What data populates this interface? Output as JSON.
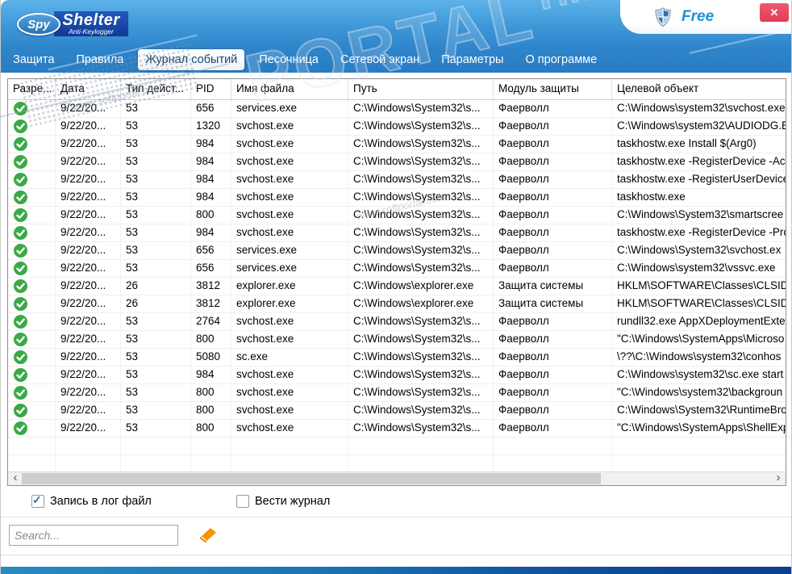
{
  "app": {
    "logo": {
      "spy": "Spy",
      "name": "Shelter",
      "subtitle": "Anti-Keylogger"
    },
    "license_badge": "Free",
    "close_glyph": "✕"
  },
  "tabs": [
    {
      "id": "protection",
      "label": "Защита",
      "active": false
    },
    {
      "id": "rules",
      "label": "Правила",
      "active": false
    },
    {
      "id": "event-log",
      "label": "Журнал событий",
      "active": true
    },
    {
      "id": "sandbox",
      "label": "Песочница",
      "active": false
    },
    {
      "id": "firewall",
      "label": "Сетевой экран",
      "active": false
    },
    {
      "id": "settings",
      "label": "Параметры",
      "active": false
    },
    {
      "id": "about",
      "label": "О программе",
      "active": false
    }
  ],
  "log_table": {
    "columns": [
      {
        "id": "allowed",
        "label": "Разре..."
      },
      {
        "id": "date",
        "label": "Дата"
      },
      {
        "id": "action-type",
        "label": "Тип дейст..."
      },
      {
        "id": "pid",
        "label": "PID"
      },
      {
        "id": "file-name",
        "label": "Имя файла"
      },
      {
        "id": "path",
        "label": "Путь"
      },
      {
        "id": "protection-module",
        "label": "Модуль защиты"
      },
      {
        "id": "target-object",
        "label": "Целевой объект"
      }
    ],
    "rows": [
      {
        "date": "9/22/20...",
        "type": "53",
        "pid": "656",
        "file": "services.exe",
        "path": "C:\\Windows\\System32\\s...",
        "module": "Фаерволл",
        "target": "C:\\Windows\\system32\\svchost.exe"
      },
      {
        "date": "9/22/20...",
        "type": "53",
        "pid": "1320",
        "file": "svchost.exe",
        "path": "C:\\Windows\\System32\\s...",
        "module": "Фаерволл",
        "target": "C:\\Windows\\system32\\AUDIODG.E"
      },
      {
        "date": "9/22/20...",
        "type": "53",
        "pid": "984",
        "file": "svchost.exe",
        "path": "C:\\Windows\\System32\\s...",
        "module": "Фаерволл",
        "target": "taskhostw.exe Install $(Arg0)"
      },
      {
        "date": "9/22/20...",
        "type": "53",
        "pid": "984",
        "file": "svchost.exe",
        "path": "C:\\Windows\\System32\\s...",
        "module": "Фаерволл",
        "target": "taskhostw.exe -RegisterDevice -Acc"
      },
      {
        "date": "9/22/20...",
        "type": "53",
        "pid": "984",
        "file": "svchost.exe",
        "path": "C:\\Windows\\System32\\s...",
        "module": "Фаерволл",
        "target": "taskhostw.exe -RegisterUserDevice"
      },
      {
        "date": "9/22/20...",
        "type": "53",
        "pid": "984",
        "file": "svchost.exe",
        "path": "C:\\Windows\\System32\\s...",
        "module": "Фаерволл",
        "target": "taskhostw.exe"
      },
      {
        "date": "9/22/20...",
        "type": "53",
        "pid": "800",
        "file": "svchost.exe",
        "path": "C:\\Windows\\System32\\s...",
        "module": "Фаерволл",
        "target": "C:\\Windows\\System32\\smartscree"
      },
      {
        "date": "9/22/20...",
        "type": "53",
        "pid": "984",
        "file": "svchost.exe",
        "path": "C:\\Windows\\System32\\s...",
        "module": "Фаерволл",
        "target": "taskhostw.exe -RegisterDevice -Pro"
      },
      {
        "date": "9/22/20...",
        "type": "53",
        "pid": "656",
        "file": "services.exe",
        "path": "C:\\Windows\\System32\\s...",
        "module": "Фаерволл",
        "target": "C:\\Windows\\System32\\svchost.ex"
      },
      {
        "date": "9/22/20...",
        "type": "53",
        "pid": "656",
        "file": "services.exe",
        "path": "C:\\Windows\\System32\\s...",
        "module": "Фаерволл",
        "target": "C:\\Windows\\system32\\vssvc.exe"
      },
      {
        "date": "9/22/20...",
        "type": "26",
        "pid": "3812",
        "file": "explorer.exe",
        "path": "C:\\Windows\\explorer.exe",
        "module": "Защита системы",
        "target": "HKLM\\SOFTWARE\\Classes\\CLSID\\{"
      },
      {
        "date": "9/22/20...",
        "type": "26",
        "pid": "3812",
        "file": "explorer.exe",
        "path": "C:\\Windows\\explorer.exe",
        "module": "Защита системы",
        "target": "HKLM\\SOFTWARE\\Classes\\CLSID\\{"
      },
      {
        "date": "9/22/20...",
        "type": "53",
        "pid": "2764",
        "file": "svchost.exe",
        "path": "C:\\Windows\\System32\\s...",
        "module": "Фаерволл",
        "target": "rundll32.exe AppXDeploymentExte"
      },
      {
        "date": "9/22/20...",
        "type": "53",
        "pid": "800",
        "file": "svchost.exe",
        "path": "C:\\Windows\\System32\\s...",
        "module": "Фаерволл",
        "target": "\"C:\\Windows\\SystemApps\\Microso"
      },
      {
        "date": "9/22/20...",
        "type": "53",
        "pid": "5080",
        "file": "sc.exe",
        "path": "C:\\Windows\\System32\\s...",
        "module": "Фаерволл",
        "target": "\\??\\C:\\Windows\\system32\\conhos"
      },
      {
        "date": "9/22/20...",
        "type": "53",
        "pid": "984",
        "file": "svchost.exe",
        "path": "C:\\Windows\\System32\\s...",
        "module": "Фаерволл",
        "target": "C:\\Windows\\system32\\sc.exe start"
      },
      {
        "date": "9/22/20...",
        "type": "53",
        "pid": "800",
        "file": "svchost.exe",
        "path": "C:\\Windows\\System32\\s...",
        "module": "Фаерволл",
        "target": "\"C:\\Windows\\system32\\backgroun"
      },
      {
        "date": "9/22/20...",
        "type": "53",
        "pid": "800",
        "file": "svchost.exe",
        "path": "C:\\Windows\\System32\\s...",
        "module": "Фаерволл",
        "target": "C:\\Windows\\System32\\RuntimeBro"
      },
      {
        "date": "9/22/20...",
        "type": "53",
        "pid": "800",
        "file": "svchost.exe",
        "path": "C:\\Windows\\System32\\s...",
        "module": "Фаерволл",
        "target": "\"C:\\Windows\\SystemApps\\ShellExp"
      }
    ],
    "empty_rows": 3
  },
  "scrollbar": {
    "left_arrow": "‹",
    "right_arrow": "›"
  },
  "footer": {
    "log_to_file": {
      "label": "Запись в лог файл",
      "checked": true
    },
    "keep_journal": {
      "label": "Вести журнал",
      "checked": false
    },
    "search": {
      "placeholder": "Search..."
    }
  },
  "watermark": {
    "big": "PORTAL™",
    "small": "www.softportal.com"
  },
  "colors": {
    "accent_blue": "#2a7cc2",
    "active_tab_text": "#17466e",
    "free_text": "#1f8fd6",
    "close_red": "#e8425c",
    "check_green": "#3ba946",
    "eraser_orange": "#f59300"
  }
}
